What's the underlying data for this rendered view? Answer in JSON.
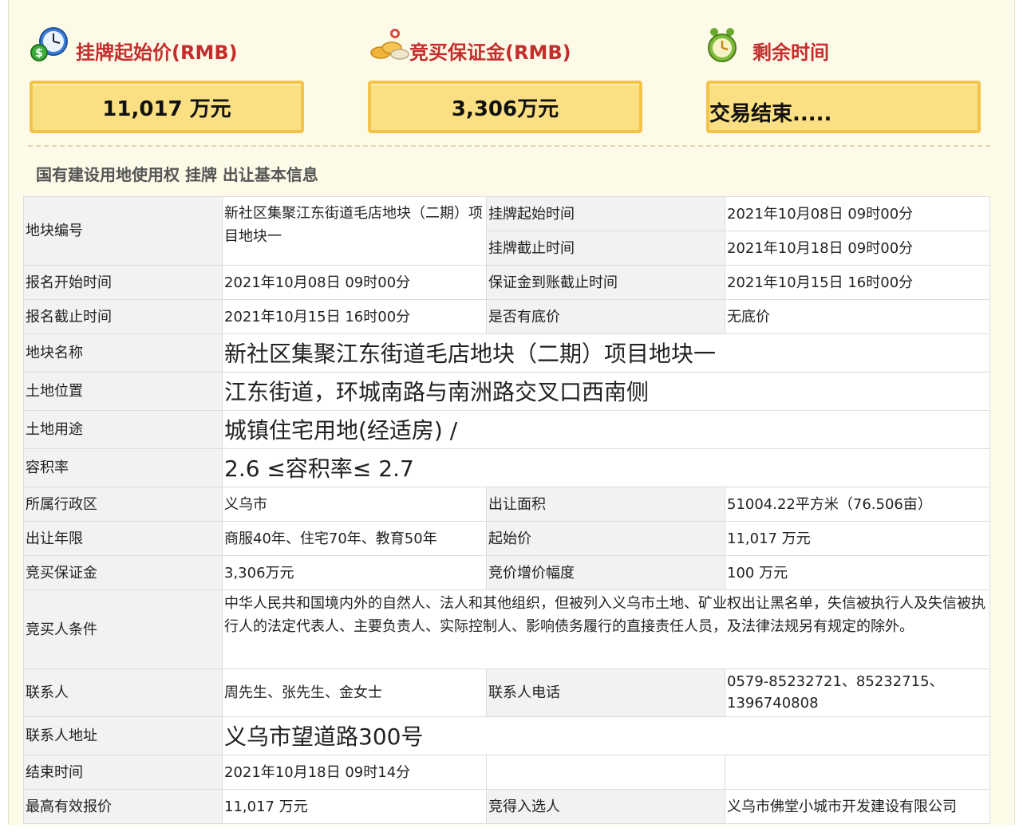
{
  "summary": {
    "start_price_label": "挂牌起始价(RMB)",
    "start_price_value": "11,017 万元",
    "deposit_label": "竞买保证金(RMB)",
    "deposit_value": "3,306万元",
    "remaining_label": "剩余时间",
    "remaining_value": "交易结束.....",
    "icons": [
      "clock-money-icon",
      "coins-icon",
      "alarm-clock-icon"
    ]
  },
  "section_title": "国有建设用地使用权 挂牌 出让基本信息",
  "table": {
    "parcel_no_label": "地块编号",
    "parcel_no_value": "新社区集聚江东街道毛店地块（二期）项目地块一",
    "listing_start_label": "挂牌起始时间",
    "listing_start_value": "2021年10月08日 09时00分",
    "listing_end_label": "挂牌截止时间",
    "listing_end_value": "2021年10月18日 09时00分",
    "reg_start_label": "报名开始时间",
    "reg_start_value": "2021年10月08日 09时00分",
    "deposit_deadline_label": "保证金到账截止时间",
    "deposit_deadline_value": "2021年10月15日 16时00分",
    "reg_end_label": "报名截止时间",
    "reg_end_value": "2021年10月15日 16时00分",
    "reserve_label": "是否有底价",
    "reserve_value": "无底价",
    "parcel_name_label": "地块名称",
    "parcel_name_value": "新社区集聚江东街道毛店地块（二期）项目地块一",
    "location_label": "土地位置",
    "location_value": "江东街道，环城南路与南洲路交叉口西南侧",
    "usage_label": "土地用途",
    "usage_value": "城镇住宅用地(经适房) /",
    "far_label": "容积率",
    "far_value": "2.6 ≤容积率≤ 2.7",
    "district_label": "所属行政区",
    "district_value": "义乌市",
    "area_label": "出让面积",
    "area_value": "51004.22平方米（76.506亩）",
    "term_label": "出让年限",
    "term_value": "商服40年、住宅70年、教育50年",
    "start_price_label": "起始价",
    "start_price_value": "11,017 万元",
    "bid_deposit_label": "竞买保证金",
    "bid_deposit_value": "3,306万元",
    "increment_label": "竞价增价幅度",
    "increment_value": "100 万元",
    "bidder_cond_label": "竞买人条件",
    "bidder_cond_value": "中华人民共和国境内外的自然人、法人和其他组织，但被列入义乌市土地、矿业权出让黑名单，失信被执行人及失信被执行人的法定代表人、主要负责人、实际控制人、影响债务履行的直接责任人员，及法律法规另有规定的除外。",
    "contact_label": "联系人",
    "contact_value": "周先生、张先生、金女士",
    "phone_label": "联系人电话",
    "phone_value": "0579-85232721、85232715、1396740808",
    "address_label": "联系人地址",
    "address_value": "义乌市望道路300号",
    "end_time_label": "结束时间",
    "end_time_value": "2021年10月18日 09时14分",
    "top_bid_label": "最高有效报价",
    "top_bid_value": "11,017 万元",
    "winner_label": "竞得入选人",
    "winner_value": "义乌市佛堂小城市开发建设有限公司"
  }
}
